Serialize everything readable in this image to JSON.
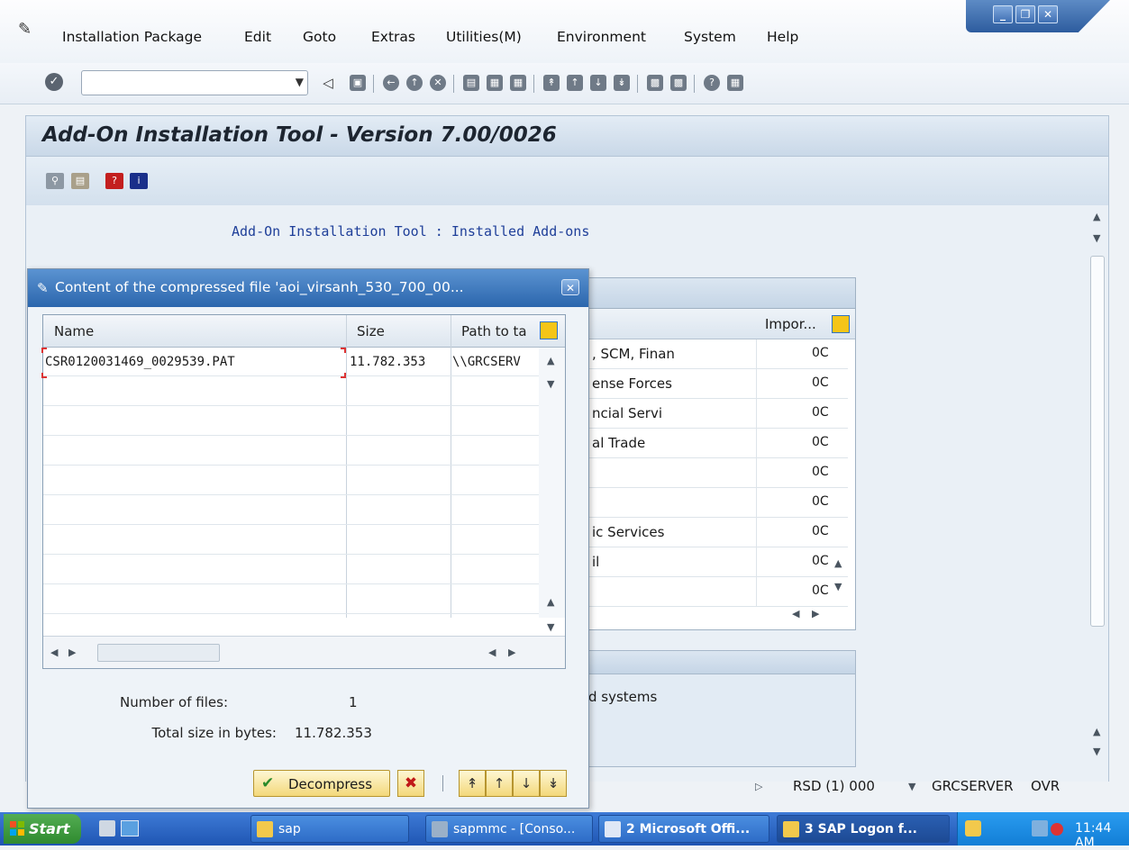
{
  "menu": {
    "items": [
      "Installation Package",
      "Edit",
      "Goto",
      "Extras",
      "Utilities(M)",
      "Environment",
      "System",
      "Help"
    ]
  },
  "toolbar": {
    "command_field_value": ""
  },
  "screen": {
    "title": "Add-On Installation Tool - Version 7.00/0026",
    "heading": "Add-On Installation Tool : Installed Add-ons"
  },
  "background_table": {
    "column_label": "Impor...",
    "rows": [
      {
        "text": ", SCM, Finan",
        "value": "0C"
      },
      {
        "text": "ense Forces",
        "value": "0C"
      },
      {
        "text": "ncial Servi",
        "value": "0C"
      },
      {
        "text": "al Trade",
        "value": "0C"
      },
      {
        "text": "",
        "value": "0C"
      },
      {
        "text": "",
        "value": "0C"
      },
      {
        "text": "ic Services",
        "value": "0C"
      },
      {
        "text": "il",
        "value": "0C"
      },
      {
        "text": "",
        "value": "0C"
      }
    ]
  },
  "background_panel": {
    "text": "d systems"
  },
  "status": {
    "system": "RSD (1) 000",
    "server": "GRCSERVER",
    "mode": "OVR"
  },
  "dialog": {
    "title": "Content of the compressed file 'aoi_virsanh_530_700_00...",
    "columns": [
      "Name",
      "Size",
      "Path to ta"
    ],
    "rows": [
      {
        "name": "CSR0120031469_0029539.PAT",
        "size": "11.782.353",
        "path": "\\\\GRCSERV"
      }
    ],
    "summary": {
      "files_label": "Number of files:",
      "files_value": "1",
      "size_label": "Total size in bytes:",
      "size_value": "11.782.353"
    },
    "decompress_label": "Decompress"
  },
  "taskbar": {
    "start_label": "Start",
    "tasks": [
      "sap",
      "sapmmc - [Conso...",
      "2 Microsoft Offi...",
      "3 SAP Logon f..."
    ],
    "clock": "11:44 AM"
  },
  "colors": {
    "dialog_title_bg": "#2b66ad",
    "button_gold": "#f3d87a",
    "heading_blue": "#1f3f99",
    "taskbar_blue": "#1f55b3"
  }
}
